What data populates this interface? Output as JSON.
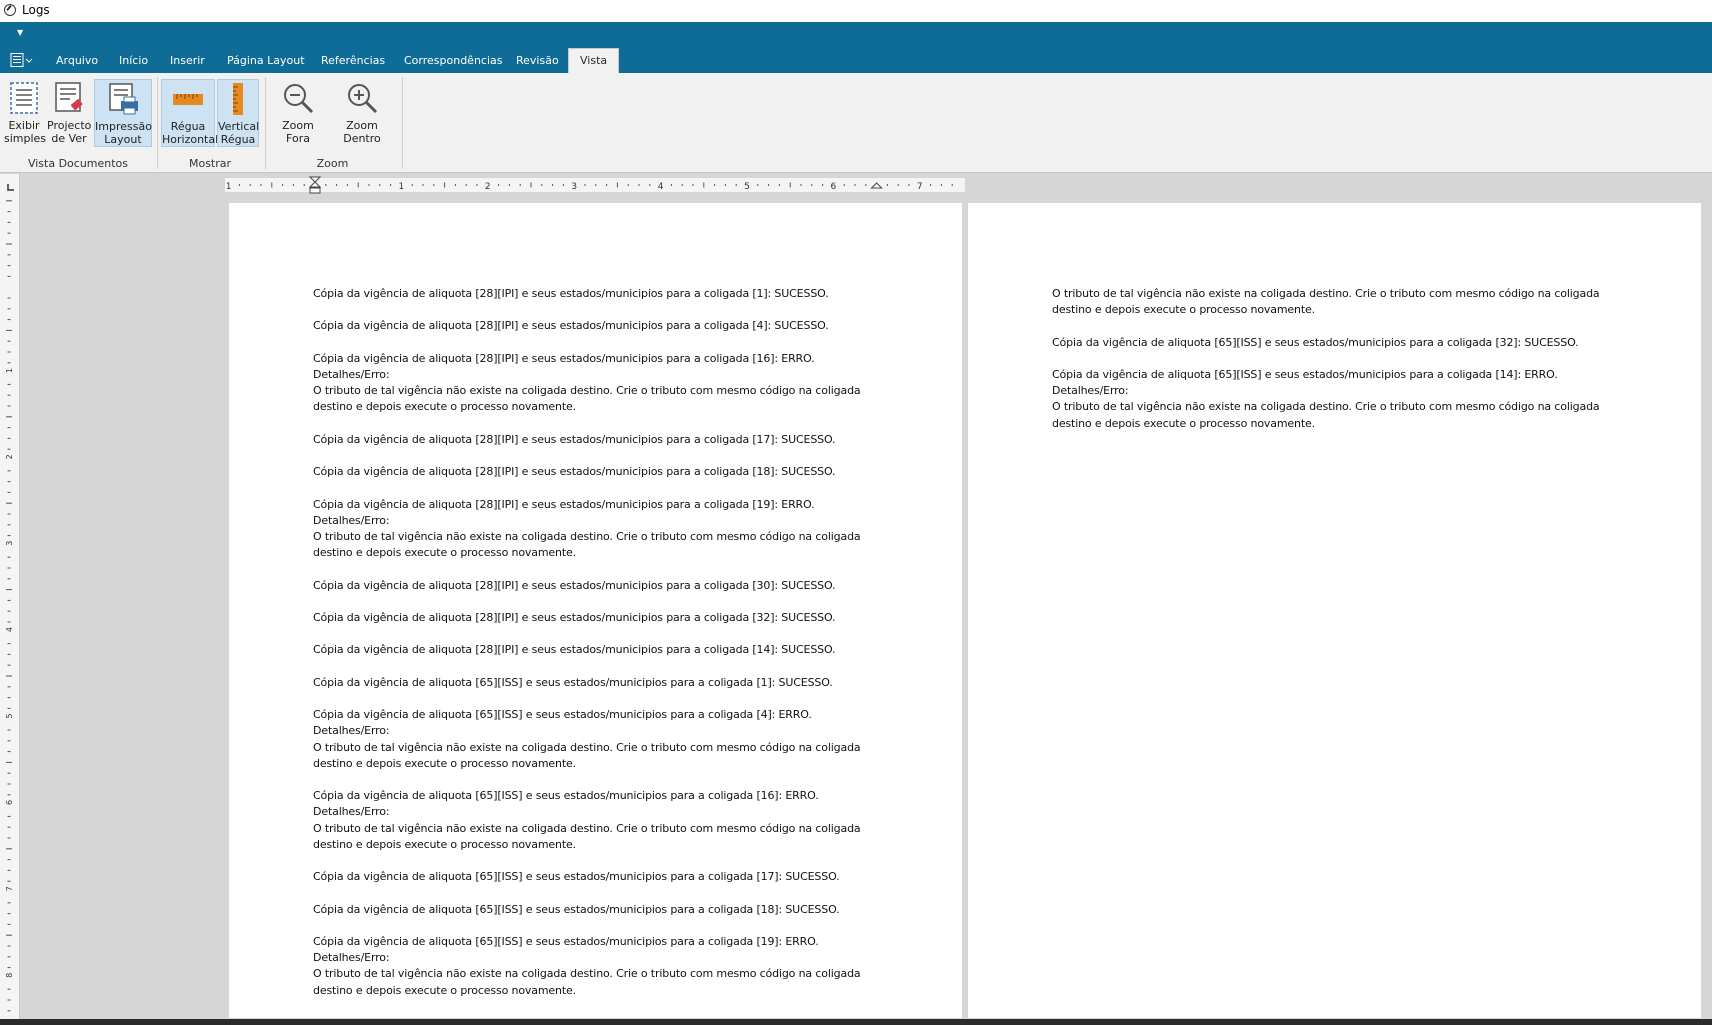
{
  "window": {
    "title": "Logs"
  },
  "tabs": [
    {
      "label": "Arquivo",
      "active": false
    },
    {
      "label": "Início",
      "active": false
    },
    {
      "label": "Inserir",
      "active": false
    },
    {
      "label": "Página Layout",
      "active": false
    },
    {
      "label": "Referências",
      "active": false
    },
    {
      "label": "Correspondências",
      "active": false
    },
    {
      "label": "Revisão",
      "active": false
    },
    {
      "label": "Vista",
      "active": true
    }
  ],
  "ribbon": {
    "groups": {
      "vista_documentos": {
        "label": "Vista Documentos",
        "buttons": {
          "exibir_simples": {
            "label": "Exibir\nsimples",
            "icon": "simple-view-icon",
            "pressed": false
          },
          "projecto_de_ver": {
            "label": "Projecto\nde Ver",
            "icon": "draft-view-icon",
            "pressed": false
          },
          "impressao_layout": {
            "label": "Impressão\nLayout",
            "icon": "print-layout-icon",
            "pressed": true
          }
        }
      },
      "mostrar": {
        "label": "Mostrar",
        "buttons": {
          "regua_horizontal": {
            "label": "Régua\nHorizontal",
            "icon": "horizontal-ruler-icon",
            "pressed": true
          },
          "vertical_regua": {
            "label": "Vertical\nRégua",
            "icon": "vertical-ruler-icon",
            "pressed": true
          }
        }
      },
      "zoom": {
        "label": "Zoom",
        "buttons": {
          "zoom_fora": {
            "label": "Zoom Fora",
            "icon": "zoom-out-icon",
            "pressed": false
          },
          "zoom_dentro": {
            "label": "Zoom Dentro",
            "icon": "zoom-in-icon",
            "pressed": false
          }
        }
      }
    }
  },
  "ruler": {
    "numbers": [
      "1",
      "1",
      "2",
      "3",
      "4",
      "5",
      "6",
      "7"
    ]
  },
  "vruler": {
    "numbers": [
      "1",
      "2",
      "3",
      "4",
      "5",
      "6",
      "7",
      "8"
    ]
  },
  "colors": {
    "ribbon_blue": "#0f6c96",
    "ribbon_bg": "#f1f1f1",
    "pressed_bg": "#cde3f4",
    "ruler_orange": "#e6891f"
  },
  "document": {
    "page1": [
      "Cópia da vigência de aliquota [28][IPI] e seus estados/municipios para a coligada [1]: SUCESSO.",
      "Cópia da vigência de aliquota [28][IPI] e seus estados/municipios para a coligada [4]: SUCESSO.",
      "Cópia da vigência de aliquota [28][IPI] e seus estados/municipios para a coligada [16]: ERRO.\nDetalhes/Erro:\nO tributo de tal vigência não existe na coligada destino. Crie o tributo com mesmo código na coligada\ndestino e depois execute o processo novamente.",
      "Cópia da vigência de aliquota [28][IPI] e seus estados/municipios para a coligada [17]: SUCESSO.",
      "Cópia da vigência de aliquota [28][IPI] e seus estados/municipios para a coligada [18]: SUCESSO.",
      "Cópia da vigência de aliquota [28][IPI] e seus estados/municipios para a coligada [19]: ERRO.\nDetalhes/Erro:\nO tributo de tal vigência não existe na coligada destino. Crie o tributo com mesmo código na coligada\ndestino e depois execute o processo novamente.",
      "Cópia da vigência de aliquota [28][IPI] e seus estados/municipios para a coligada [30]: SUCESSO.",
      "Cópia da vigência de aliquota [28][IPI] e seus estados/municipios para a coligada [32]: SUCESSO.",
      "Cópia da vigência de aliquota [28][IPI] e seus estados/municipios para a coligada [14]: SUCESSO.",
      "Cópia da vigência de aliquota [65][ISS] e seus estados/municipios para a coligada [1]: SUCESSO.",
      "Cópia da vigência de aliquota [65][ISS] e seus estados/municipios para a coligada [4]: ERRO.\nDetalhes/Erro:\nO tributo de tal vigência não existe na coligada destino. Crie o tributo com mesmo código na coligada\ndestino e depois execute o processo novamente.",
      "Cópia da vigência de aliquota [65][ISS] e seus estados/municipios para a coligada [16]: ERRO.\nDetalhes/Erro:\nO tributo de tal vigência não existe na coligada destino. Crie o tributo com mesmo código na coligada\ndestino e depois execute o processo novamente.",
      "Cópia da vigência de aliquota [65][ISS] e seus estados/municipios para a coligada [17]: SUCESSO.",
      "Cópia da vigência de aliquota [65][ISS] e seus estados/municipios para a coligada [18]: SUCESSO.",
      "Cópia da vigência de aliquota [65][ISS] e seus estados/municipios para a coligada [19]: ERRO.\nDetalhes/Erro:\nO tributo de tal vigência não existe na coligada destino. Crie o tributo com mesmo código na coligada\ndestino e depois execute o processo novamente."
    ],
    "page2": [
      "O tributo de tal vigência não existe na coligada destino. Crie o tributo com mesmo código na coligada\ndestino e depois execute o processo novamente.",
      "Cópia da vigência de aliquota [65][ISS] e seus estados/municipios para a coligada [32]: SUCESSO.",
      "Cópia da vigência de aliquota [65][ISS] e seus estados/municipios para a coligada [14]: ERRO.\nDetalhes/Erro:\nO tributo de tal vigência não existe na coligada destino. Crie o tributo com mesmo código na coligada\ndestino e depois execute o processo novamente."
    ]
  }
}
